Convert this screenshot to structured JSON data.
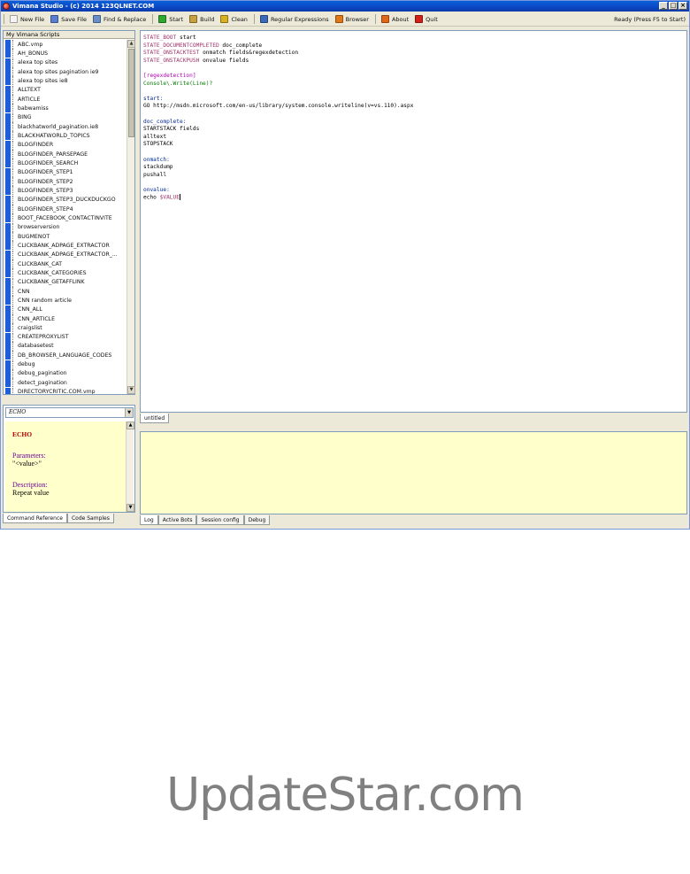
{
  "window": {
    "title": "Vimana Studio - (c) 2014 123QLNET.COM",
    "controls": [
      "_",
      "□",
      "×"
    ]
  },
  "toolbar": {
    "items": [
      {
        "label": "New File",
        "icon": "new-file-icon",
        "color": "#f4f4f4"
      },
      {
        "label": "Save File",
        "icon": "save-icon",
        "color": "#5a7fd0"
      },
      {
        "label": "Find & Replace",
        "icon": "search-icon",
        "color": "#6a8fc8"
      },
      {
        "label": "Start",
        "icon": "play-icon",
        "color": "#2ea82e"
      },
      {
        "label": "Build",
        "icon": "build-icon",
        "color": "#c8a040"
      },
      {
        "label": "Clean",
        "icon": "broom-icon",
        "color": "#d8b020"
      },
      {
        "label": "Regular Expressions",
        "icon": "regex-icon",
        "color": "#3a6ab8"
      },
      {
        "label": "Browser",
        "icon": "browser-icon",
        "color": "#e07818"
      },
      {
        "label": "About",
        "icon": "about-icon",
        "color": "#e06818"
      },
      {
        "label": "Quit",
        "icon": "quit-icon",
        "color": "#d02018"
      }
    ],
    "status": "Ready (Press F5 to Start)"
  },
  "scripts": {
    "header": "My Vimana Scripts",
    "items": [
      "ABC.vmp",
      "AH_BONUS",
      "alexa top sites",
      "alexa top sites pagination ie9",
      "alexa top sites ie8",
      "ALLTEXT",
      "ARTICLE",
      "babwamiss",
      "BING",
      "blackhatworld_pagination.ie8",
      "BLACKHATWORLD_TOPICS",
      "BLOGFINDER",
      "BLOGFINDER_PARSEPAGE",
      "BLOGFINDER_SEARCH",
      "BLOGFINDER_STEP1",
      "BLOGFINDER_STEP2",
      "BLOGFINDER_STEP3",
      "BLOGFINDER_STEP3_DUCKDUCKGO",
      "BLOGFINDER_STEP4",
      "BOOT_FACEBOOK_CONTACTINVITE",
      "browserversion",
      "BUGMENOT",
      "CLICKBANK_ADPAGE_EXTRACTOR",
      "CLICKBANK_ADPAGE_EXTRACTOR_...",
      "CLICKBANK_CAT",
      "CLICKBANK_CATEGORIES",
      "CLICKBANK_GETAFFLINK",
      "CNN",
      "CNN random article",
      "CNN_ALL",
      "CNN_ARTICLE",
      "craigslist",
      "CREATEPROXYLIST",
      "databasetest",
      "DB_BROWSER_LANGUAGE_CODES",
      "debug",
      "debug_pagination",
      "detect_pagination",
      "DIRECTORYCRITIC.COM.vmp"
    ]
  },
  "reference": {
    "selected": "ECHO",
    "title": "ECHO",
    "params_label": "Parameters:",
    "params_value": "\"<value>\"",
    "desc_label": "Description:",
    "desc_value": "Repeat value",
    "tabs": [
      "Command Reference",
      "Code Samples"
    ]
  },
  "editor": {
    "lines": [
      {
        "t": "STATE_BOOT",
        "c": "c-kw",
        "r": " start"
      },
      {
        "t": "STATE_DOCUMENTCOMPLETED",
        "c": "c-kw",
        "r": " doc_complete"
      },
      {
        "t": "STATE_ONSTACKTEST",
        "c": "c-kw",
        "r": " onmatch fields&regexdetection"
      },
      {
        "t": "STATE_ONSTACKPUSH",
        "c": "c-kw",
        "r": " onvalue fields"
      },
      {
        "t": "",
        "c": "",
        "r": ""
      },
      {
        "t": "[regexdetection]",
        "c": "c-mag",
        "r": ""
      },
      {
        "t": "Console\\.Write(Line)?",
        "c": "c-grn",
        "r": ""
      },
      {
        "t": "",
        "c": "",
        "r": ""
      },
      {
        "t": "start:",
        "c": "c-blu",
        "r": ""
      },
      {
        "t": "GO",
        "c": "",
        "r": " http://msdn.microsoft.com/en-us/library/system.console.writeline(v=vs.110).aspx"
      },
      {
        "t": "",
        "c": "",
        "r": ""
      },
      {
        "t": "doc_complete:",
        "c": "c-blu",
        "r": ""
      },
      {
        "t": "STARTSTACK",
        "c": "",
        "r": " fields"
      },
      {
        "t": "alltext",
        "c": "",
        "r": ""
      },
      {
        "t": "STOPSTACK",
        "c": "",
        "r": ""
      },
      {
        "t": "",
        "c": "",
        "r": ""
      },
      {
        "t": "onmatch:",
        "c": "c-blu",
        "r": ""
      },
      {
        "t": "stackdump",
        "c": "",
        "r": ""
      },
      {
        "t": "pushall",
        "c": "",
        "r": ""
      },
      {
        "t": "",
        "c": "",
        "r": ""
      },
      {
        "t": "onvalue:",
        "c": "c-blu",
        "r": ""
      },
      {
        "t": "echo",
        "c": "",
        "r": " $VALUE"
      }
    ],
    "tab": "untitled"
  },
  "log": {
    "tabs": [
      "Log",
      "Active Bots",
      "Session config",
      "Debug"
    ]
  },
  "watermark": "UpdateStar.com"
}
